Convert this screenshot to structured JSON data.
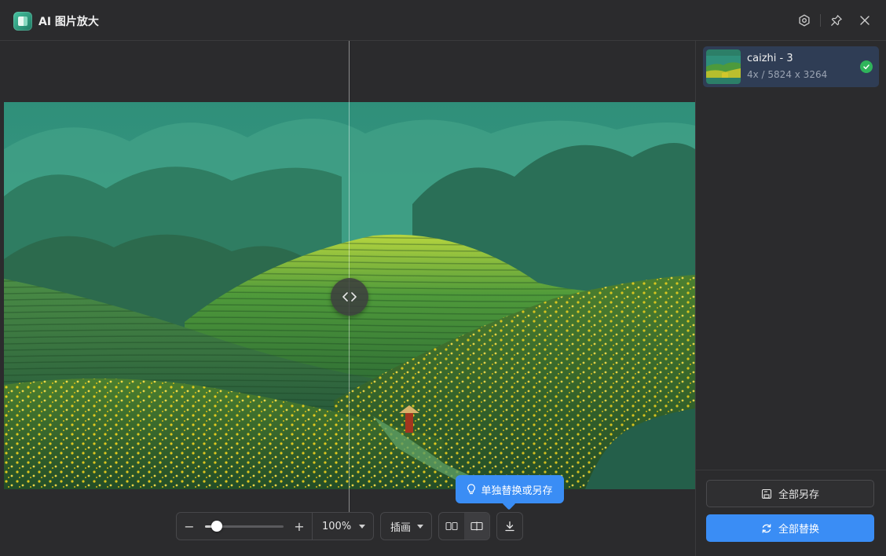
{
  "window": {
    "title": "AI 图片放大"
  },
  "canvas": {
    "zoom_value": "100%",
    "zoom_level": 0.15,
    "mode_label": "插画",
    "tooltip": "单独替换或另存"
  },
  "sidebar": {
    "files": [
      {
        "name": "caizhi - 3",
        "meta": "4x / 5824 x 3264",
        "status": "done"
      }
    ],
    "save_all_label": "全部另存",
    "replace_all_label": "全部替换"
  },
  "colors": {
    "accent": "#3a8df5",
    "success": "#2fb45b",
    "selected_item": "#2f3d55"
  },
  "icons": {
    "settings": "gear-icon",
    "pin": "pin-icon",
    "close": "close-icon",
    "compare": "split-compare-icon",
    "download": "download-icon",
    "check": "check-icon"
  }
}
